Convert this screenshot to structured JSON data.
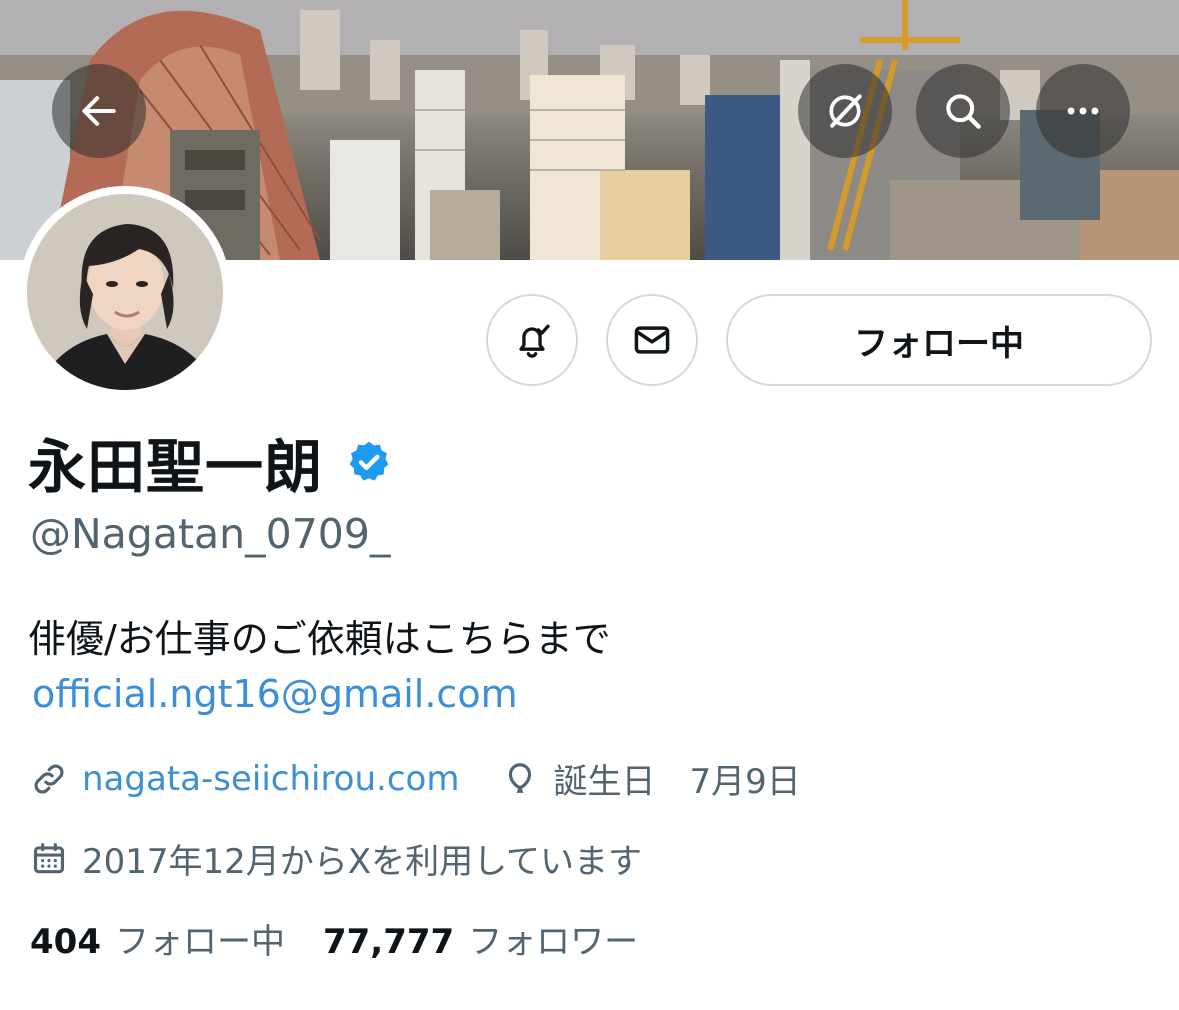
{
  "header": {
    "back_icon": "arrow-left-icon",
    "grok_icon": "grok-icon",
    "search_icon": "search-icon",
    "more_icon": "more-icon"
  },
  "actions": {
    "notify_icon": "bell-check-icon",
    "message_icon": "envelope-icon",
    "follow_label": "フォロー中"
  },
  "profile": {
    "name": "永田聖一朗",
    "handle": "@Nagatan_0709_",
    "bio": "俳優/お仕事のご依頼はこちらまで",
    "email": "official.ngt16@gmail.com",
    "website": "nagata-seiichirou.com",
    "birthday": "誕生日　7月9日",
    "joined": "2017年12月からXを利用しています"
  },
  "stats": {
    "following_count": "404",
    "following_label": "フォロー中",
    "followers_count": "77,777",
    "followers_label": "フォロワー"
  },
  "colors": {
    "link": "#3b8fd6",
    "secondary_text": "#536471",
    "verified": "#1d9bf0",
    "border": "#cfd9de"
  }
}
